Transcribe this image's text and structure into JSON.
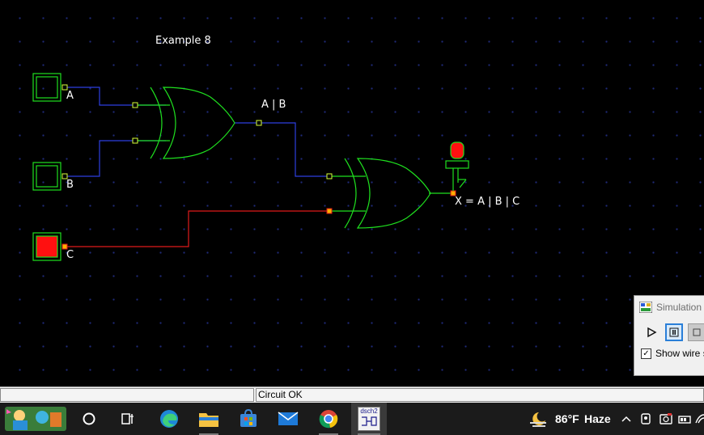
{
  "canvas": {
    "title": "Example 8",
    "inputs": [
      {
        "label": "A",
        "state": "off"
      },
      {
        "label": "B",
        "state": "off"
      },
      {
        "label": "C",
        "state": "on"
      }
    ],
    "intermediate_label": "A | B",
    "output_label": "X = A | B | C",
    "colors": {
      "gate": "#1fe01f",
      "wire_low": "#2d3fe0",
      "wire_high": "#e01b1b",
      "led_on": "#ff1010",
      "grid_dot": "#1f2a7a"
    }
  },
  "sim_panel": {
    "title": "Simulation",
    "checkbox_label": "Show wire st",
    "checkbox_checked": true
  },
  "statusbar": {
    "left_text": "",
    "right_text": "Circuit OK"
  },
  "taskbar": {
    "apps": [
      "widgets-icon",
      "start-search-icon",
      "task-view-icon",
      "edge-icon",
      "file-explorer-icon",
      "store-icon",
      "mail-icon",
      "chrome-icon",
      "dsch2-icon"
    ],
    "dsch_label": "dsch2",
    "weather_temp": "86°F",
    "weather_condition": "Haze"
  }
}
